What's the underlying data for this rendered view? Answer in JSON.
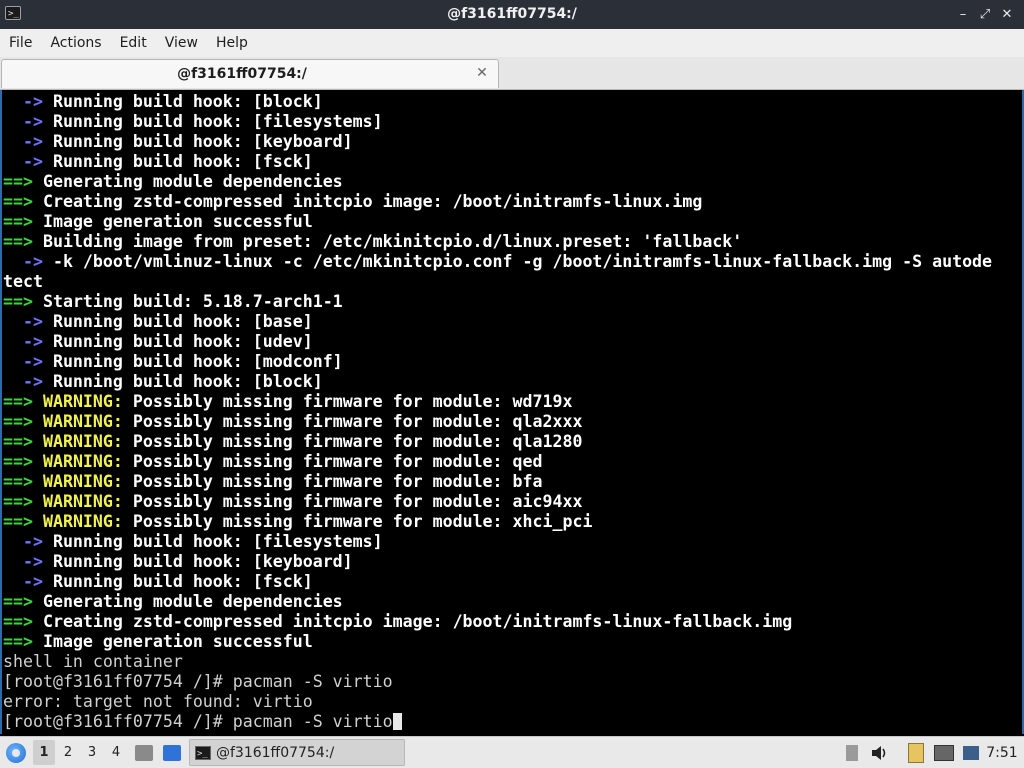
{
  "window": {
    "title": "@f3161ff07754:/",
    "app_icon_glyph": ">_",
    "controls": {
      "minimize": "–",
      "maximize": "⤢",
      "close": "✕"
    }
  },
  "menubar": [
    "File",
    "Actions",
    "Edit",
    "View",
    "Help"
  ],
  "tab": {
    "label": "@f3161ff07754:/",
    "close": "✕"
  },
  "terminal": {
    "colors": {
      "arrow": "#7272ff",
      "gt": "#3ed43e",
      "warning": "#f2f24e",
      "text": "#ffffff",
      "plain": "#d0d0d0",
      "background": "#000000"
    },
    "lines": [
      {
        "type": "arrow",
        "text": "Running build hook: [block]"
      },
      {
        "type": "arrow",
        "text": "Running build hook: [filesystems]"
      },
      {
        "type": "arrow",
        "text": "Running build hook: [keyboard]"
      },
      {
        "type": "arrow",
        "text": "Running build hook: [fsck]"
      },
      {
        "type": "gt",
        "text": "Generating module dependencies"
      },
      {
        "type": "gt",
        "text": "Creating zstd-compressed initcpio image: /boot/initramfs-linux.img"
      },
      {
        "type": "gt",
        "text": "Image generation successful"
      },
      {
        "type": "gt",
        "text": "Building image from preset: /etc/mkinitcpio.d/linux.preset: 'fallback'"
      },
      {
        "type": "arrow",
        "text": "-k /boot/vmlinuz-linux -c /etc/mkinitcpio.conf -g /boot/initramfs-linux-fallback.img -S autode"
      },
      {
        "type": "wrap",
        "text": "tect"
      },
      {
        "type": "gt",
        "text": "Starting build: 5.18.7-arch1-1"
      },
      {
        "type": "arrow",
        "text": "Running build hook: [base]"
      },
      {
        "type": "arrow",
        "text": "Running build hook: [udev]"
      },
      {
        "type": "arrow",
        "text": "Running build hook: [modconf]"
      },
      {
        "type": "arrow",
        "text": "Running build hook: [block]"
      },
      {
        "type": "warn",
        "label": "WARNING:",
        "text": "Possibly missing firmware for module: wd719x"
      },
      {
        "type": "warn",
        "label": "WARNING:",
        "text": "Possibly missing firmware for module: qla2xxx"
      },
      {
        "type": "warn",
        "label": "WARNING:",
        "text": "Possibly missing firmware for module: qla1280"
      },
      {
        "type": "warn",
        "label": "WARNING:",
        "text": "Possibly missing firmware for module: qed"
      },
      {
        "type": "warn",
        "label": "WARNING:",
        "text": "Possibly missing firmware for module: bfa"
      },
      {
        "type": "warn",
        "label": "WARNING:",
        "text": "Possibly missing firmware for module: aic94xx"
      },
      {
        "type": "warn",
        "label": "WARNING:",
        "text": "Possibly missing firmware for module: xhci_pci"
      },
      {
        "type": "arrow",
        "text": "Running build hook: [filesystems]"
      },
      {
        "type": "arrow",
        "text": "Running build hook: [keyboard]"
      },
      {
        "type": "arrow",
        "text": "Running build hook: [fsck]"
      },
      {
        "type": "gt",
        "text": "Generating module dependencies"
      },
      {
        "type": "gt",
        "text": "Creating zstd-compressed initcpio image: /boot/initramfs-linux-fallback.img"
      },
      {
        "type": "gt",
        "text": "Image generation successful"
      },
      {
        "type": "plain",
        "text": "shell in container"
      },
      {
        "type": "plain",
        "text": "[root@f3161ff07754 /]# pacman -S virtio"
      },
      {
        "type": "plain",
        "text": "error: target not found: virtio"
      }
    ],
    "prompt": "[root@f3161ff07754 /]# pacman -S virtio"
  },
  "taskbar": {
    "workspaces": [
      "1",
      "2",
      "3",
      "4"
    ],
    "active_workspace": "1",
    "quicklaunch": [
      {
        "name": "file-manager-icon",
        "color": "#8a8a8a"
      },
      {
        "name": "desktop-icon",
        "color": "#2f73d9"
      }
    ],
    "task": {
      "label": "@f3161ff07754:/",
      "icon_glyph": ">_"
    },
    "tray": [
      {
        "name": "eject-icon",
        "glyph": "⏏"
      },
      {
        "name": "volume-icon",
        "glyph": "🔊"
      },
      {
        "name": "clipboard-icon",
        "glyph": "📋"
      },
      {
        "name": "display-icon",
        "glyph": "⎕"
      },
      {
        "name": "network-icon",
        "glyph": "⎕"
      }
    ],
    "clock": "7:51"
  }
}
